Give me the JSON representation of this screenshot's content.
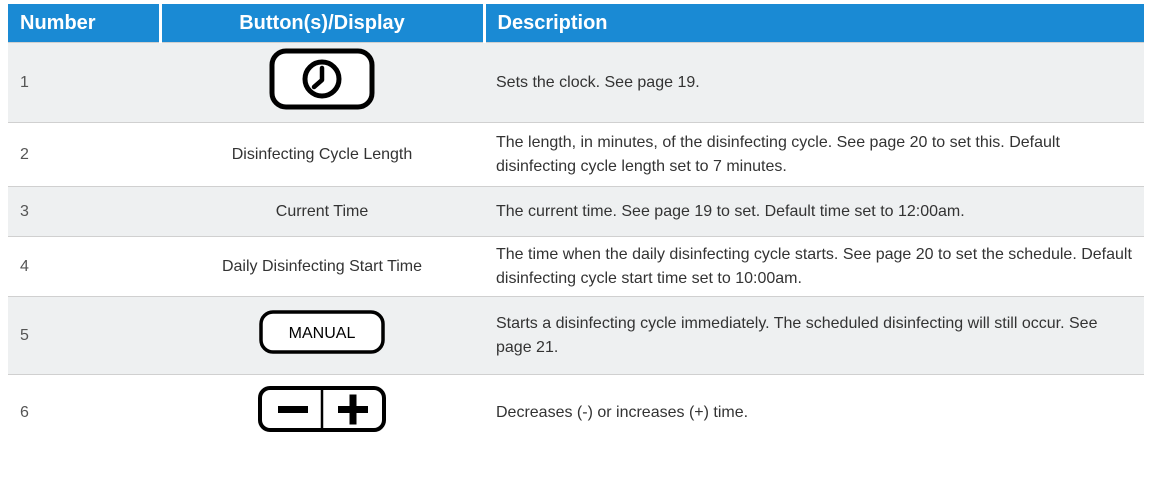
{
  "header": {
    "number": "Number",
    "button_display": "Button(s)/Display",
    "description": "Description"
  },
  "rows": [
    {
      "number": "1",
      "display": "",
      "icon": "clock-icon",
      "description": "Sets the clock. See page 19."
    },
    {
      "number": "2",
      "display": "Disinfecting Cycle Length",
      "description": "The length, in minutes, of the disinfecting cycle. See page 20 to set this. Default disinfecting cycle length set to 7 minutes."
    },
    {
      "number": "3",
      "display": "Current Time",
      "description": "The current time. See page 19 to set. Default time set to 12:00am."
    },
    {
      "number": "4",
      "display": "Daily Disinfecting Start Time",
      "description": "The time when the daily disinfecting cycle starts. See page 20 to set the schedule. Default disinfecting cycle start time set to 10:00am."
    },
    {
      "number": "5",
      "display": "",
      "button_label": "MANUAL",
      "description": "Starts a disinfecting cycle immediately. The scheduled disinfecting will still occur. See page 21."
    },
    {
      "number": "6",
      "display": "",
      "icon": "minus-plus-icon",
      "description": "Decreases (-) or increases (+) time."
    }
  ],
  "colors": {
    "header_bg": "#1a8ad4",
    "row_shade": "#eef0f1"
  }
}
